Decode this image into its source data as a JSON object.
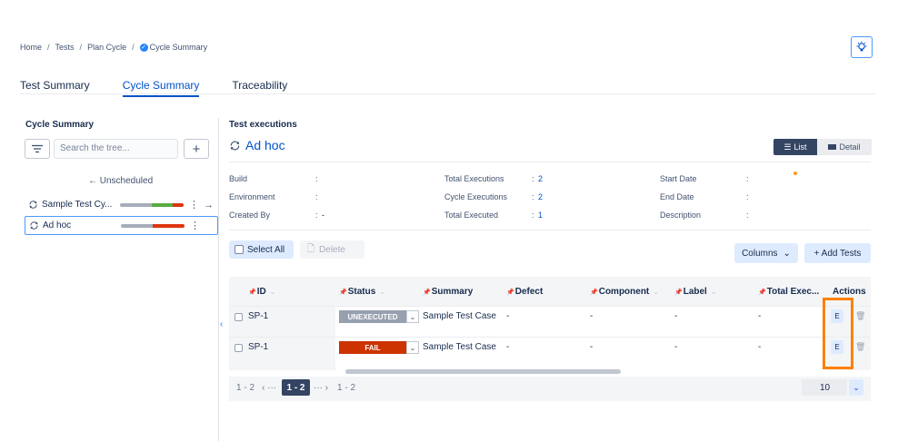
{
  "breadcrumb": {
    "home": "Home",
    "tests": "Tests",
    "plan_cycle": "Plan Cycle",
    "current": "Cycle Summary"
  },
  "tabs": [
    "Test Summary",
    "Cycle Summary",
    "Traceability"
  ],
  "active_tab": "Cycle Summary",
  "left_panel": {
    "title": "Cycle Summary",
    "search_placeholder": "Search the tree...",
    "add_label": "+",
    "unscheduled": "← Unscheduled",
    "items": [
      {
        "label": "Sample Test Cy...",
        "progress": {
          "unexecuted": 0.5,
          "pass": 0.33,
          "fail": 0.17
        },
        "selected": false
      },
      {
        "label": "Ad hoc",
        "progress": {
          "unexecuted": 0.5,
          "pass": 0,
          "fail": 0.5
        },
        "selected": true
      }
    ]
  },
  "main": {
    "section_title": "Test executions",
    "cycle_name": "Ad hoc",
    "view_list": "List",
    "view_detail": "Detail",
    "info": {
      "build": {
        "label": "Build",
        "value": ""
      },
      "environment": {
        "label": "Environment",
        "value": ""
      },
      "created_by": {
        "label": "Created By",
        "value": "-"
      },
      "total_executions": {
        "label": "Total Executions",
        "value": "2"
      },
      "cycle_executions": {
        "label": "Cycle Executions",
        "value": "2"
      },
      "total_executed": {
        "label": "Total Executed",
        "value": "1"
      },
      "start_date": {
        "label": "Start Date",
        "value": ""
      },
      "end_date": {
        "label": "End Date",
        "value": ""
      },
      "description": {
        "label": "Description",
        "value": ""
      }
    },
    "toolbar": {
      "select_all": "Select All",
      "delete": "Delete",
      "columns": "Columns",
      "add_tests": "+ Add Tests"
    },
    "table": {
      "headers": {
        "id": "ID",
        "status": "Status",
        "summary": "Summary",
        "defect": "Defect",
        "component": "Component",
        "label": "Label",
        "total_exec": "Total Exec...",
        "actions": "Actions"
      },
      "rows": [
        {
          "id": "SP-1",
          "status": "UNEXECUTED",
          "status_color": "#97a0af",
          "summary": "Sample Test Case",
          "defect": "-",
          "component": "-",
          "label": "-",
          "total_exec": "-",
          "edit": "E"
        },
        {
          "id": "SP-1",
          "status": "FAIL",
          "status_color": "#cc3300",
          "summary": "Sample Test Case",
          "defect": "-",
          "component": "-",
          "label": "-",
          "total_exec": "-",
          "edit": "E"
        }
      ]
    },
    "pagination": {
      "range_left": "1 - 2",
      "prev": "‹ ···",
      "current": "1 - 2",
      "next": "··· ›",
      "range_right": "1 - 2",
      "per_page": "10"
    }
  },
  "colors": {
    "unexecuted": "#a5adba",
    "pass": "#5aac44",
    "fail": "#de350b",
    "accent": "#0052cc",
    "highlight": "#ff8000"
  }
}
